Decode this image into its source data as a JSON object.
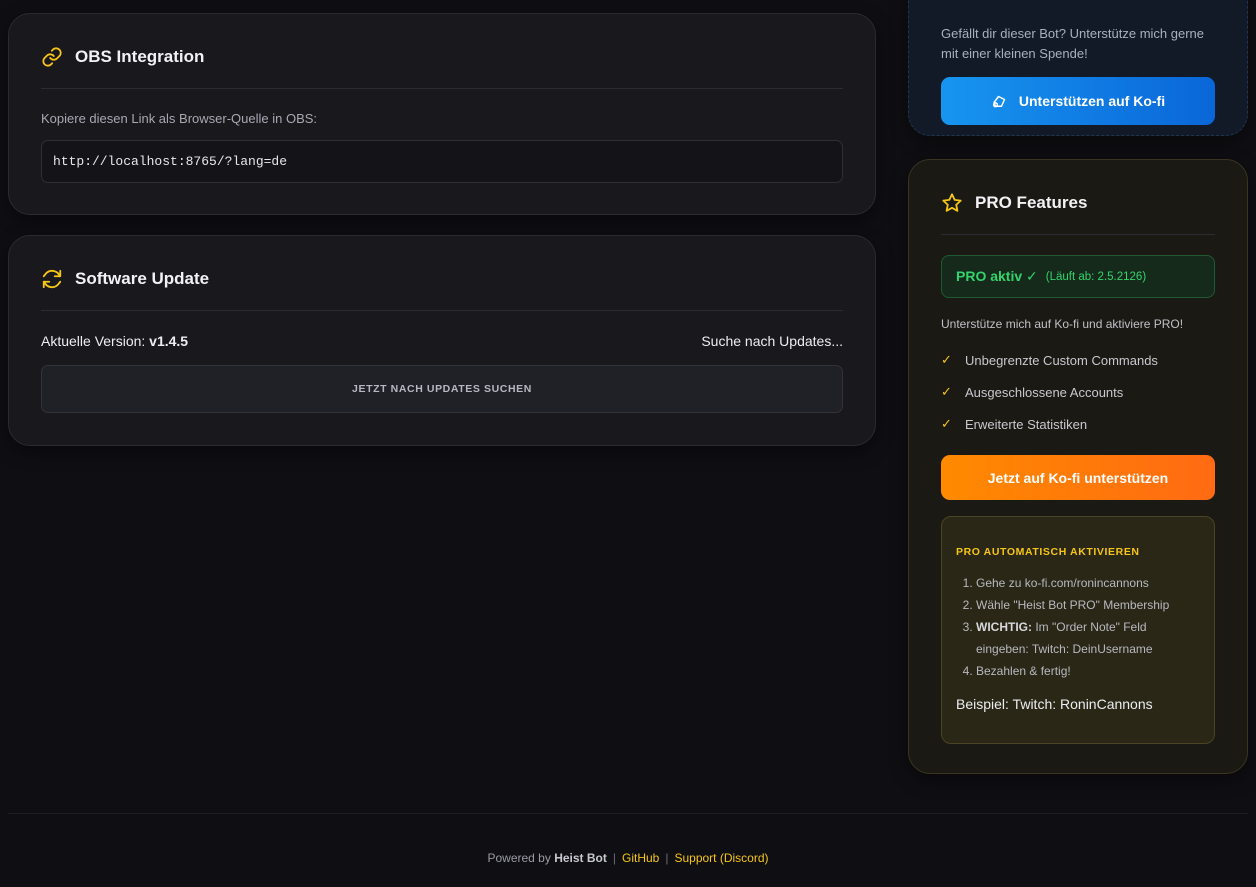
{
  "obs": {
    "title": "OBS Integration",
    "hint": "Kopiere diesen Link als Browser-Quelle in OBS:",
    "url": "http://localhost:8765/?lang=de"
  },
  "update": {
    "title": "Software Update",
    "version_label": "Aktuelle Version: ",
    "version": "v1.4.5",
    "status": "Suche nach Updates...",
    "button": "JETZT NACH UPDATES SUCHEN"
  },
  "kofi": {
    "text": "Gefällt dir dieser Bot? Unterstütze mich gerne mit einer kleinen Spende!",
    "button": "Unterstützen auf Ko-fi",
    "accent": "#1795f0"
  },
  "pro": {
    "title": "PRO Features",
    "status_main": "PRO aktiv ✓",
    "status_sub": "(Läuft ab: 2.5.2126)",
    "description": "Unterstütze mich auf Ko-fi und aktiviere PRO!",
    "features": [
      "Unbegrenzte Custom Commands",
      "Ausgeschlossene Accounts",
      "Erweiterte Statistiken"
    ],
    "cta": "Jetzt auf Ko-fi unterstützen",
    "auto_title": "PRO AUTOMATISCH AKTIVIEREN",
    "steps": [
      "Gehe zu ko-fi.com/ronincannons",
      "Wähle \"Heist Bot PRO\" Membership",
      "Im \"Order Note\" Feld eingeben: Twitch: DeinUsername",
      "Bezahlen & fertig!"
    ],
    "step3_bold": "WICHTIG:",
    "example": "Beispiel: Twitch: RoninCannons",
    "accent": "#f5c518"
  },
  "footer": {
    "powered": "Powered by ",
    "brand": "Heist Bot",
    "github": "GitHub",
    "support": "Support (Discord)"
  }
}
